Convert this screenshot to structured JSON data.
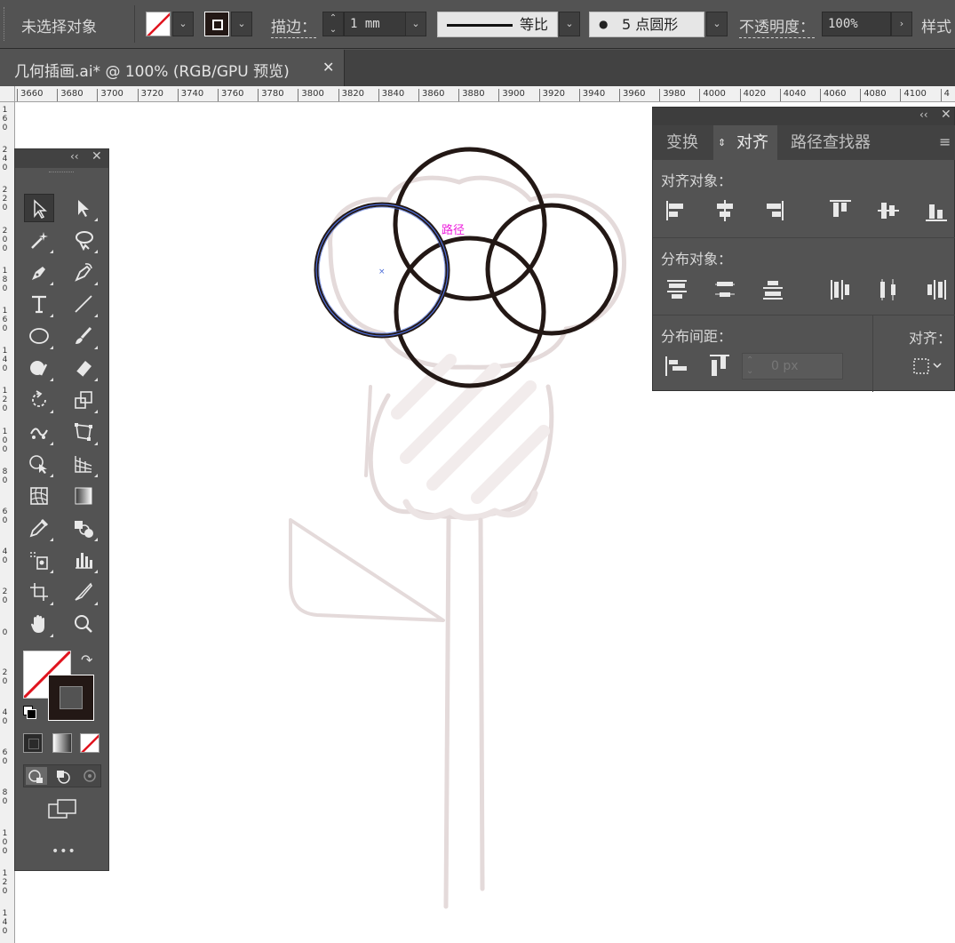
{
  "control_bar": {
    "selection_status": "未选择对象",
    "stroke_label": "描边：",
    "stroke_weight": "1 mm",
    "stroke_profile": "等比",
    "brush": "5 点圆形",
    "opacity_label": "不透明度：",
    "opacity_value": "100%",
    "style_label": "样式",
    "fill_color": "none",
    "stroke_color": "#231815"
  },
  "document_tab": {
    "title": "几何插画.ai* @ 100% (RGB/GPU 预览)",
    "close_glyph": "✕"
  },
  "ruler": {
    "top_ticks": [
      "3660",
      "3680",
      "3700",
      "3720",
      "3740",
      "3760",
      "3780",
      "3800",
      "3820",
      "3840",
      "3860",
      "3880",
      "3900",
      "3920",
      "3940",
      "3960",
      "3980",
      "4000",
      "4020",
      "4040",
      "4060",
      "4080",
      "4100",
      "4"
    ],
    "left_ticks": [
      "1\n6\n0",
      "2\n4\n0",
      "2\n2\n0",
      "2\n0\n0",
      "1\n8\n0",
      "1\n6\n0",
      "1\n4\n0",
      "1\n2\n0",
      "1\n0\n0",
      "8\n0",
      "6\n0",
      "4\n0",
      "2\n0",
      "0",
      "2\n0",
      "4\n0",
      "6\n0",
      "8\n0",
      "1\n0\n0",
      "1\n2\n0",
      "1\n4\n0"
    ]
  },
  "canvas": {
    "smart_guide_label": "路径",
    "stroke_color": "#231815",
    "sketch_color": "#e6dcdc",
    "selection_color": "#4a6bd8"
  },
  "tools_panel": {
    "collapse_glyph": "‹‹",
    "close_glyph": "✕",
    "more_glyph": "•••"
  },
  "align_panel": {
    "collapse_glyph": "‹‹",
    "close_glyph": "✕",
    "tabs": [
      "变换",
      "对齐",
      "路径查找器"
    ],
    "align_objects": "对齐对象：",
    "distribute_objects": "分布对象：",
    "distribute_spacing": "分布间距：",
    "align_to": "对齐：",
    "spacing_value": "0 px"
  }
}
